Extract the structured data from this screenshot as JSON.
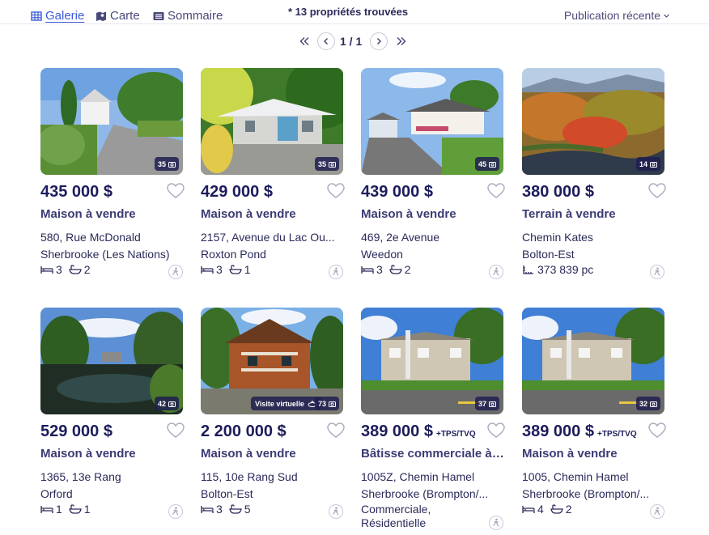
{
  "toolbar": {
    "views": [
      {
        "label": "Galerie",
        "icon": "grid-icon",
        "active": true
      },
      {
        "label": "Carte",
        "icon": "map-icon",
        "active": false
      },
      {
        "label": "Sommaire",
        "icon": "list-icon",
        "active": false
      }
    ],
    "count_text": "* 13 propriétés trouvées",
    "sort_label": "Publication récente"
  },
  "pager": {
    "text": "1 / 1"
  },
  "listings": [
    {
      "price": "435 000 $",
      "tax": "",
      "type": "Maison à vendre",
      "address": "580, Rue McDonald",
      "city": "Sherbrooke (Les Nations)",
      "beds": "3",
      "baths": "2",
      "area": "",
      "photos": "35",
      "virtual": "",
      "extra1": "",
      "extra2": ""
    },
    {
      "price": "429 000 $",
      "tax": "",
      "type": "Maison à vendre",
      "address": "2157, Avenue du Lac Ou...",
      "city": "Roxton Pond",
      "beds": "3",
      "baths": "1",
      "area": "",
      "photos": "35",
      "virtual": "",
      "extra1": "",
      "extra2": ""
    },
    {
      "price": "439 000 $",
      "tax": "",
      "type": "Maison à vendre",
      "address": "469, 2e Avenue",
      "city": "Weedon",
      "beds": "3",
      "baths": "2",
      "area": "",
      "photos": "45",
      "virtual": "",
      "extra1": "",
      "extra2": ""
    },
    {
      "price": "380 000 $",
      "tax": "",
      "type": "Terrain à vendre",
      "address": "Chemin Kates",
      "city": "Bolton-Est",
      "beds": "",
      "baths": "",
      "area": "373 839 pc",
      "photos": "14",
      "virtual": "",
      "extra1": "",
      "extra2": ""
    },
    {
      "price": "529 000 $",
      "tax": "",
      "type": "Maison à vendre",
      "address": "1365, 13e Rang",
      "city": "Orford",
      "beds": "1",
      "baths": "1",
      "area": "",
      "photos": "42",
      "virtual": "",
      "extra1": "",
      "extra2": ""
    },
    {
      "price": "2 200 000 $",
      "tax": "",
      "type": "Maison à vendre",
      "address": "115, 10e Rang Sud",
      "city": "Bolton-Est",
      "beds": "3",
      "baths": "5",
      "area": "",
      "photos": "73",
      "virtual": "Visite virtuelle",
      "extra1": "",
      "extra2": ""
    },
    {
      "price": "389 000 $",
      "tax": "+TPS/TVQ",
      "type": "Bâtisse commerciale à ...",
      "address": "1005Z, Chemin Hamel",
      "city": "Sherbrooke (Brompton/...",
      "beds": "",
      "baths": "",
      "area": "",
      "photos": "37",
      "virtual": "",
      "extra1": "Commerciale,",
      "extra2": "Résidentielle"
    },
    {
      "price": "389 000 $",
      "tax": "+TPS/TVQ",
      "type": "Maison à vendre",
      "address": "1005, Chemin Hamel",
      "city": "Sherbrooke (Brompton/...",
      "beds": "4",
      "baths": "2",
      "area": "",
      "photos": "32",
      "virtual": "",
      "extra1": "",
      "extra2": ""
    }
  ]
}
